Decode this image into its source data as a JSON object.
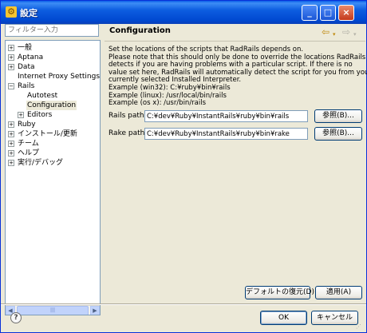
{
  "window": {
    "title": "設定"
  },
  "filter": {
    "placeholder": "フィルター入力"
  },
  "tree": {
    "items": [
      {
        "label": "一般",
        "expander": "+"
      },
      {
        "label": "Aptana",
        "expander": "+"
      },
      {
        "label": "Data",
        "expander": "+"
      },
      {
        "label": "Internet Proxy Settings",
        "expander": ""
      },
      {
        "label": "Rails",
        "expander": "−"
      },
      {
        "label": "Autotest",
        "expander": ""
      },
      {
        "label": "Configuration",
        "expander": ""
      },
      {
        "label": "Editors",
        "expander": "+"
      },
      {
        "label": "Ruby",
        "expander": "+"
      },
      {
        "label": "インストール/更新",
        "expander": "+"
      },
      {
        "label": "チーム",
        "expander": "+"
      },
      {
        "label": "ヘルプ",
        "expander": "+"
      },
      {
        "label": "実行/デバッグ",
        "expander": "+"
      }
    ]
  },
  "page": {
    "title": "Configuration",
    "description": [
      "Set the locations of the scripts that RadRails depends on.",
      "Please note that this should only be done to override the locations RadRails",
      "detects if you are having problems with a particular script. If there is no",
      "value set here, RadRails will automatically detect the script for you from your",
      "currently selected Installed Interpreter.",
      "Example (win32): C:¥ruby¥bin¥rails",
      "Example (linux): /usr/local/bin/rails",
      "Example (os x): /usr/bin/rails"
    ],
    "rails_label": "Rails path",
    "rails_path": "C:¥dev¥Ruby¥InstantRails¥ruby¥bin¥rails",
    "rake_label": "Rake path",
    "rake_path": "C:¥dev¥Ruby¥InstantRails¥ruby¥bin¥rake",
    "browse_label": "参照(B)...",
    "restore_defaults_label": "デフォルトの復元(D)",
    "apply_label": "適用(A)"
  },
  "footer": {
    "help_glyph": "?",
    "ok_label": "OK",
    "cancel_label": "キャンセル"
  },
  "colors": {
    "titlebar": "#0a5ce8",
    "dialog_bg": "#ece9d8",
    "input_border": "#7f9db9"
  }
}
